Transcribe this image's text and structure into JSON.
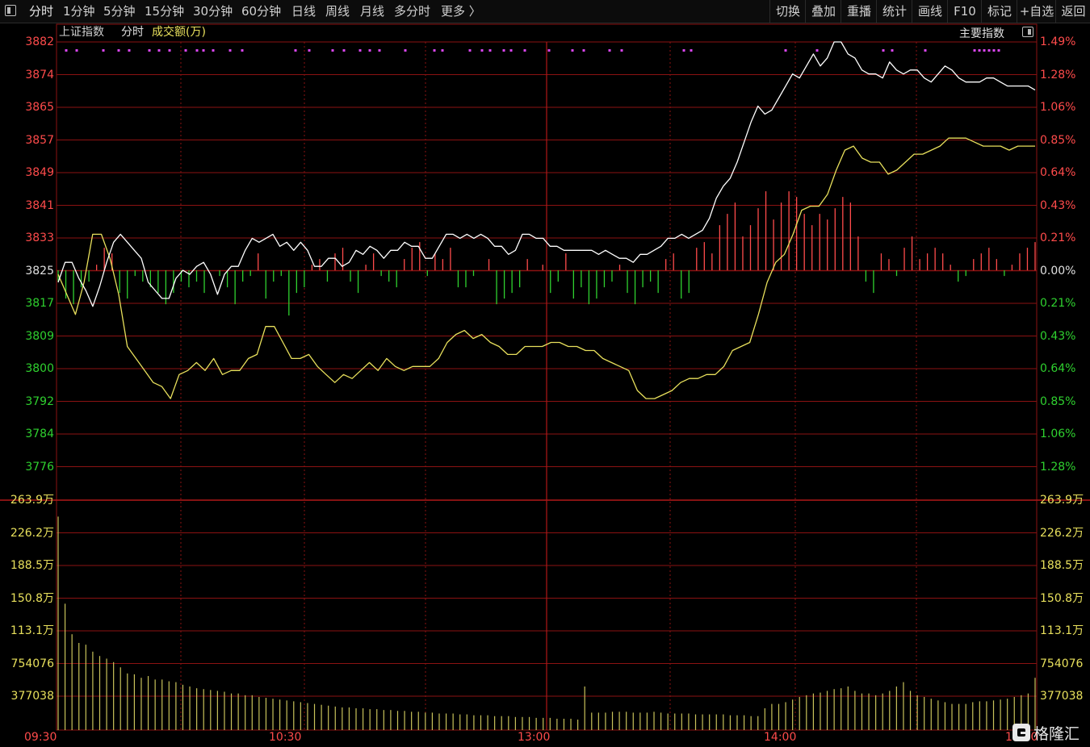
{
  "toolbar": {
    "left_icon": "panel-toggle-icon",
    "tabs": [
      {
        "label": "分时",
        "active": true
      },
      {
        "label": "1分钟"
      },
      {
        "label": "5分钟"
      },
      {
        "label": "15分钟"
      },
      {
        "label": "30分钟"
      },
      {
        "label": "60分钟"
      },
      {
        "label": "日线"
      },
      {
        "label": "周线"
      },
      {
        "label": "月线"
      },
      {
        "label": "多分时"
      },
      {
        "label": "更多 〉"
      }
    ],
    "right_buttons": [
      "切换",
      "叠加",
      "重播",
      "统计",
      "画线",
      "F10",
      "标记",
      "+自选",
      "返回"
    ]
  },
  "header": {
    "index_name": "上证指数",
    "mode": "分时",
    "volume_label": "成交额(万)",
    "main_index_label": "主要指数"
  },
  "colors": {
    "up": "#ff4b4b",
    "down": "#2fd12f",
    "price_line": "#ffffff",
    "avg_line": "#e8e05c",
    "grid": "#8b1212",
    "signal_dots": "#d946ef",
    "volume": "#c8c25a"
  },
  "price_axis": {
    "labels": [
      "3882",
      "3874",
      "3865",
      "3857",
      "3849",
      "3841",
      "3833",
      "3825",
      "3817",
      "3809",
      "3800",
      "3792",
      "3784",
      "3776"
    ],
    "pct": [
      "1.49%",
      "1.28%",
      "1.06%",
      "0.85%",
      "0.64%",
      "0.43%",
      "0.21%",
      "0.00%",
      "0.21%",
      "0.43%",
      "0.64%",
      "0.85%",
      "1.06%",
      "1.28%"
    ],
    "base": 3825
  },
  "volume_axis": {
    "labels": [
      "263.9万",
      "226.2万",
      "188.5万",
      "150.8万",
      "113.1万",
      "754076",
      "377038"
    ]
  },
  "time_axis": [
    "09:30",
    "10:30",
    "13:00",
    "14:00",
    "15:00"
  ],
  "chart_data": {
    "type": "line",
    "price_ylim": [
      3776,
      3882
    ],
    "volume_ylim": [
      0,
      2639000
    ],
    "series": [
      {
        "name": "price",
        "values": [
          3822,
          3827,
          3827,
          3823,
          3820,
          3816,
          3821,
          3827,
          3832,
          3834,
          3832,
          3830,
          3828,
          3822,
          3820,
          3818,
          3818,
          3823,
          3825,
          3824,
          3826,
          3827,
          3824,
          3819,
          3824,
          3826,
          3826,
          3830,
          3833,
          3832,
          3833,
          3834,
          3831,
          3832,
          3830,
          3832,
          3830,
          3826,
          3826,
          3828,
          3828,
          3826,
          3827,
          3830,
          3829,
          3831,
          3830,
          3828,
          3830,
          3830,
          3832,
          3831,
          3831,
          3828,
          3828,
          3831,
          3834,
          3834,
          3833,
          3834,
          3833,
          3834,
          3833,
          3831,
          3831,
          3829,
          3830,
          3834,
          3834,
          3833,
          3833,
          3831,
          3831,
          3830,
          3830,
          3830,
          3830,
          3830,
          3829,
          3830,
          3829,
          3828,
          3828,
          3827,
          3829,
          3829,
          3830,
          3831,
          3833,
          3833,
          3834,
          3833,
          3834,
          3835,
          3838,
          3843,
          3846,
          3848,
          3852,
          3857,
          3862,
          3866,
          3864,
          3865,
          3868,
          3871,
          3874,
          3873,
          3876,
          3879,
          3876,
          3878,
          3882,
          3882,
          3879,
          3878,
          3875,
          3874,
          3874,
          3873,
          3877,
          3875,
          3874,
          3875,
          3875,
          3873,
          3872,
          3874,
          3876,
          3875,
          3873,
          3872,
          3872,
          3872,
          3873,
          3873,
          3872,
          3871,
          3871,
          3871,
          3871,
          3870
        ],
        "note_x": "session minute index (sampled)"
      },
      {
        "name": "avg",
        "values": [
          3824,
          3819,
          3814,
          3822,
          3834,
          3834,
          3828,
          3819,
          3806,
          3803,
          3800,
          3797,
          3796,
          3793,
          3799,
          3800,
          3802,
          3800,
          3803,
          3799,
          3800,
          3800,
          3803,
          3804,
          3811,
          3811,
          3807,
          3803,
          3803,
          3804,
          3801,
          3799,
          3797,
          3799,
          3798,
          3800,
          3802,
          3800,
          3803,
          3801,
          3800,
          3801,
          3801,
          3801,
          3803,
          3807,
          3809,
          3810,
          3808,
          3809,
          3807,
          3806,
          3804,
          3804,
          3806,
          3806,
          3806,
          3807,
          3807,
          3806,
          3806,
          3805,
          3805,
          3803,
          3802,
          3801,
          3800,
          3795,
          3793,
          3793,
          3794,
          3795,
          3797,
          3798,
          3798,
          3799,
          3799,
          3801,
          3805,
          3806,
          3807,
          3814,
          3822,
          3827,
          3829,
          3834,
          3840,
          3841,
          3841,
          3844,
          3850,
          3855,
          3856,
          3853,
          3852,
          3852,
          3849,
          3850,
          3852,
          3854,
          3854,
          3855,
          3856,
          3858,
          3858,
          3858,
          3857,
          3856,
          3856,
          3856,
          3855,
          3856,
          3856,
          3856
        ]
      },
      {
        "name": "breadth",
        "values": [
          -2,
          -5,
          -6,
          -3,
          -2,
          1,
          4,
          3,
          -4,
          -5,
          -1,
          -2,
          -3,
          -4,
          -6,
          -4,
          -2,
          -3,
          -2,
          -4,
          0,
          -1,
          -3,
          -6,
          -2,
          -1,
          3,
          -5,
          -2,
          -1,
          -8,
          -4,
          -3,
          1,
          2,
          -2,
          3,
          4,
          -2,
          -4,
          1,
          3,
          -1,
          -2,
          -3,
          2,
          4,
          5,
          -1,
          3,
          2,
          4,
          -3,
          -3,
          -1,
          0,
          2,
          -6,
          -5,
          -4,
          -3,
          2,
          0,
          1,
          -4,
          -2,
          3,
          -5,
          -3,
          -6,
          -5,
          -3,
          -2,
          1,
          -4,
          -6,
          -3,
          -2,
          -4,
          2,
          3,
          -5,
          -4,
          4,
          5,
          3,
          8,
          10,
          12,
          6,
          8,
          11,
          14,
          9,
          12,
          14,
          13,
          10,
          8,
          10,
          9,
          11,
          13,
          12,
          6,
          -2,
          -4,
          3,
          2,
          -1,
          4,
          6,
          2,
          3,
          4,
          3,
          1,
          -2,
          -1,
          2,
          3,
          4,
          2,
          -1,
          1,
          3,
          4,
          5
        ]
      },
      {
        "name": "volume",
        "values": [
          2450000,
          1450000,
          1100000,
          1000000,
          980000,
          900000,
          850000,
          820000,
          780000,
          720000,
          650000,
          640000,
          600000,
          620000,
          580000,
          580000,
          560000,
          550000,
          520000,
          500000,
          480000,
          470000,
          460000,
          450000,
          440000,
          420000,
          420000,
          400000,
          400000,
          380000,
          370000,
          360000,
          350000,
          340000,
          330000,
          320000,
          310000,
          300000,
          290000,
          280000,
          270000,
          260000,
          260000,
          250000,
          250000,
          240000,
          240000,
          230000,
          230000,
          220000,
          220000,
          210000,
          210000,
          200000,
          200000,
          190000,
          190000,
          190000,
          180000,
          180000,
          170000,
          170000,
          170000,
          160000,
          160000,
          160000,
          150000,
          150000,
          150000,
          140000,
          140000,
          140000,
          130000,
          130000,
          130000,
          120000,
          500000,
          200000,
          200000,
          200000,
          210000,
          210000,
          210000,
          200000,
          200000,
          200000,
          210000,
          200000,
          190000,
          190000,
          190000,
          190000,
          180000,
          180000,
          180000,
          180000,
          180000,
          170000,
          170000,
          170000,
          160000,
          160000,
          250000,
          300000,
          300000,
          320000,
          350000,
          380000,
          400000,
          420000,
          430000,
          450000,
          470000,
          480000,
          500000,
          450000,
          420000,
          420000,
          400000,
          420000,
          450000,
          500000,
          550000,
          450000,
          400000,
          380000,
          360000,
          340000,
          320000,
          300000,
          300000,
          300000,
          320000,
          330000,
          330000,
          340000,
          350000,
          360000,
          380000,
          400000,
          420000,
          600000
        ]
      }
    ]
  }
}
